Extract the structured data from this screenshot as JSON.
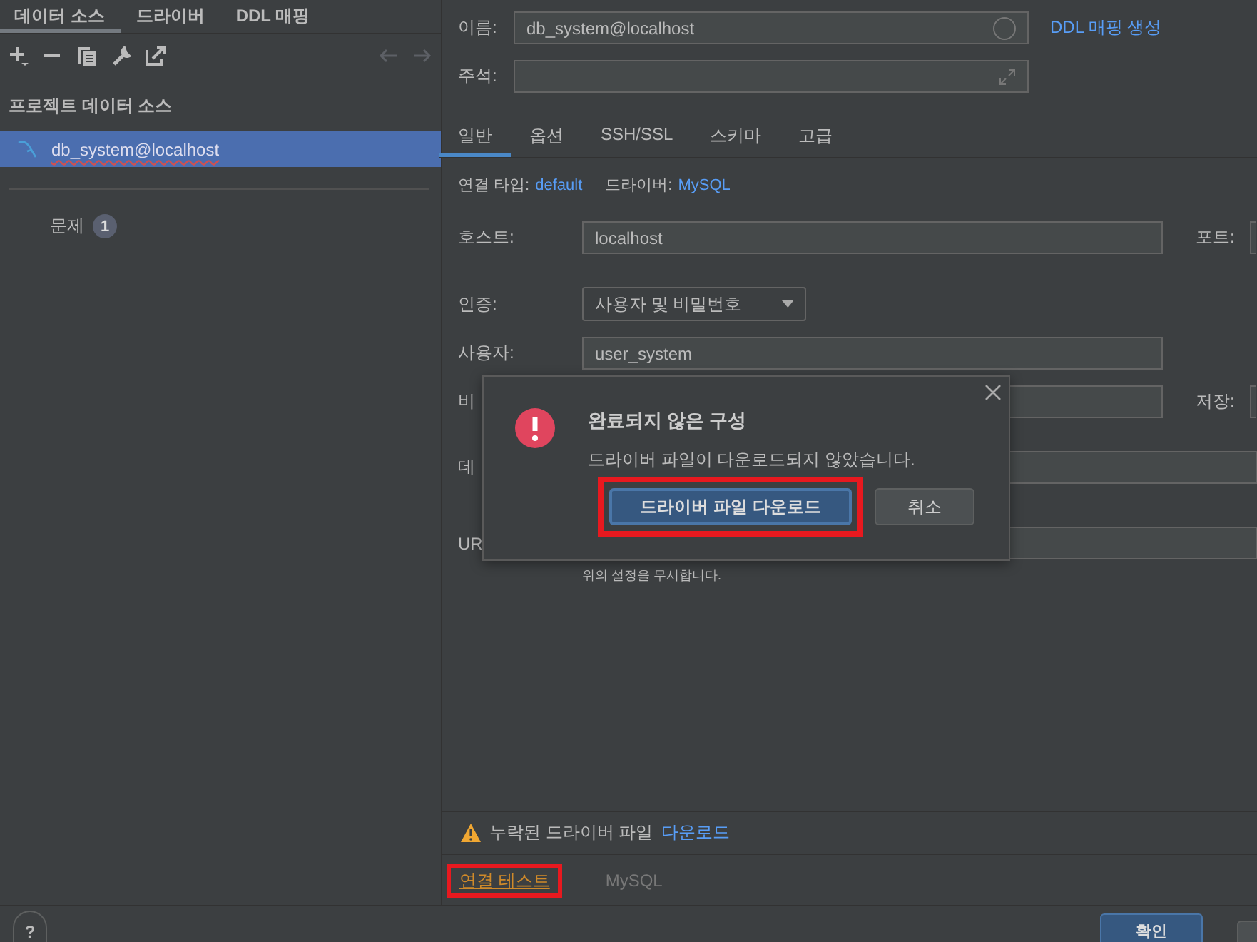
{
  "left_tabs": [
    {
      "label": "데이터 소스",
      "selected": true
    },
    {
      "label": "드라이버",
      "selected": false
    },
    {
      "label": "DDL 매핑",
      "selected": false
    }
  ],
  "sidebar": {
    "heading": "프로젝트 데이터 소스",
    "items": [
      {
        "label": "db_system@localhost",
        "selected": true
      }
    ],
    "problems": {
      "label": "문제",
      "count": "1"
    }
  },
  "form": {
    "name": {
      "label": "이름:",
      "value": "db_system@localhost"
    },
    "ddl_link": "DDL 매핑 생성",
    "comment": {
      "label": "주석:"
    }
  },
  "tabs": [
    {
      "label": "일반",
      "selected": true
    },
    {
      "label": "옵션",
      "selected": false
    },
    {
      "label": "SSH/SSL",
      "selected": false
    },
    {
      "label": "스키마",
      "selected": false
    },
    {
      "label": "고급",
      "selected": false
    }
  ],
  "info": {
    "connection_type_label": "연결 타입:",
    "connection_type": "default",
    "driver_label": "드라이버:",
    "driver": "MySQL"
  },
  "host": {
    "label": "호스트:",
    "value": "localhost"
  },
  "port": {
    "label": "포트:"
  },
  "auth": {
    "label": "인증:",
    "value": "사용자 및 비밀번호"
  },
  "user": {
    "label": "사용자:",
    "value": "user_system"
  },
  "password": {
    "label": "비"
  },
  "save": {
    "label": "저장:"
  },
  "database": {
    "label": "데"
  },
  "url": {
    "label": "UR",
    "hint": "위의 설정을 무시합니다."
  },
  "dialog": {
    "title": "완료되지 않은 구성",
    "message": "드라이버 파일이 다운로드되지 않았습니다.",
    "buttons": [
      {
        "label": "드라이버 파일 다운로드",
        "kind": "primary",
        "highlighted": true
      },
      {
        "label": "취소",
        "kind": "secondary",
        "highlighted": false
      }
    ]
  },
  "warning": {
    "text": "누락된 드라이버 파일",
    "link": "다운로드"
  },
  "footer": {
    "test_link": {
      "label": "연결 테스트",
      "highlighted": true
    },
    "driver": "MySQL"
  },
  "bottom_bar": {
    "help": "?",
    "ok": "확인"
  }
}
